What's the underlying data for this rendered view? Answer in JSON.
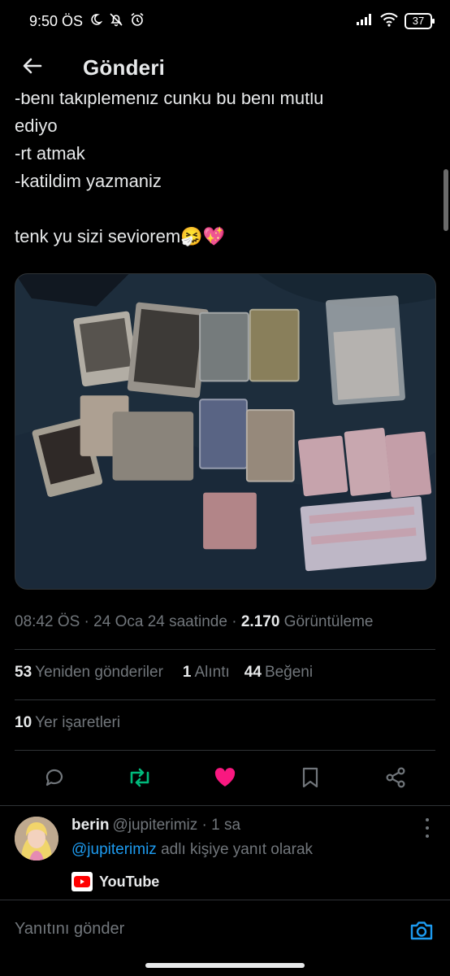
{
  "status_bar": {
    "time": "9:50 ÖS",
    "battery": "37"
  },
  "header": {
    "title": "Gönderi",
    "back_icon": "arrow-left-icon"
  },
  "tweet": {
    "lines": [
      "-beni takiplemeniz cunku bu beni mutlu",
      "ediyo",
      "-rt atmak",
      "-katildim yazmaniz",
      "",
      "tenk yu sizi seviorem🤧💖"
    ],
    "timestamp": "08:42 ÖS · 24 Oca 24 saatinde · ",
    "views_count": "2.170",
    "views_label": " Görüntüleme"
  },
  "stats": {
    "reposts_count": "53",
    "reposts_label": "Yeniden gönderiler",
    "quotes_count": "1",
    "quotes_label": "Alıntı",
    "likes_count": "44",
    "likes_label": "Beğeni",
    "bookmarks_count": "10",
    "bookmarks_label": "Yer işaretleri"
  },
  "actions": {
    "reply_icon": "reply-icon",
    "retweet_icon": "retweet-icon",
    "like_icon": "heart-icon",
    "bookmark_icon": "bookmark-icon",
    "share_icon": "share-icon"
  },
  "colors": {
    "background": "#000000",
    "text": "#e7e9ea",
    "muted": "#71767b",
    "link": "#1d9bf0",
    "retweet": "#00ba7c",
    "like": "#f91880",
    "divider": "#2f3336"
  },
  "reply": {
    "name": "berin",
    "handle": "@jupiterimiz",
    "time": " · 1 sa",
    "reply_mention": "@jupiterimiz",
    "reply_suffix": " adlı kişiye yanıt olarak",
    "source_label": "YouTube"
  },
  "composer": {
    "placeholder": "Yanıtını gönder"
  }
}
